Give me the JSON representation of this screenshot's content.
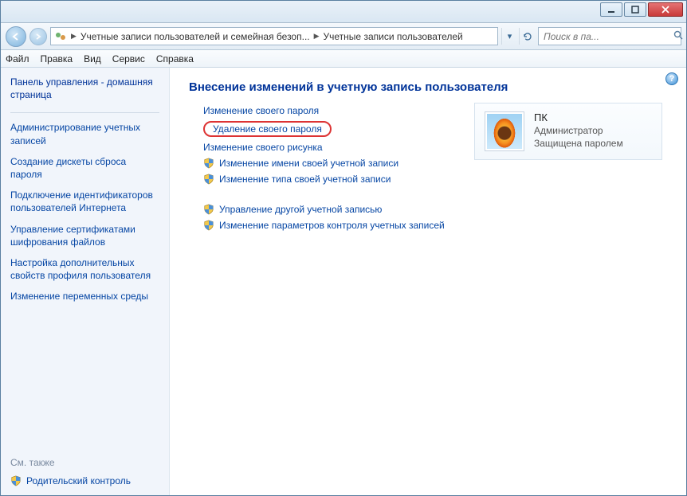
{
  "window": {
    "minimize_tip": "Свернуть",
    "maximize_tip": "Развернуть",
    "close_tip": "Закрыть"
  },
  "nav": {
    "crumb1": "Учетные записи пользователей и семейная безоп...",
    "crumb2": "Учетные записи пользователей",
    "search_placeholder": "Поиск в па..."
  },
  "menu": {
    "file": "Файл",
    "edit": "Правка",
    "view": "Вид",
    "tools": "Сервис",
    "help": "Справка"
  },
  "sidebar": {
    "cp_home": "Панель управления - домашняя страница",
    "links": [
      "Администрирование учетных записей",
      "Создание дискеты сброса пароля",
      "Подключение идентификаторов пользователей Интернета",
      "Управление сертификатами шифрования файлов",
      "Настройка дополнительных свойств профиля пользователя",
      "Изменение переменных среды"
    ],
    "see_also": "См. также",
    "parental": "Родительский контроль"
  },
  "main": {
    "heading": "Внесение изменений в учетную запись пользователя",
    "links": {
      "change_password": "Изменение своего пароля",
      "delete_password": "Удаление своего пароля",
      "change_picture": "Изменение своего рисунка",
      "change_name": "Изменение имени своей учетной записи",
      "change_type": "Изменение типа своей учетной записи",
      "manage_other": "Управление другой учетной записью",
      "uac_settings": "Изменение параметров контроля учетных записей"
    }
  },
  "user": {
    "name": "ПК",
    "role": "Администратор",
    "protected": "Защищена паролем"
  },
  "help": {
    "tip": "Справка"
  }
}
